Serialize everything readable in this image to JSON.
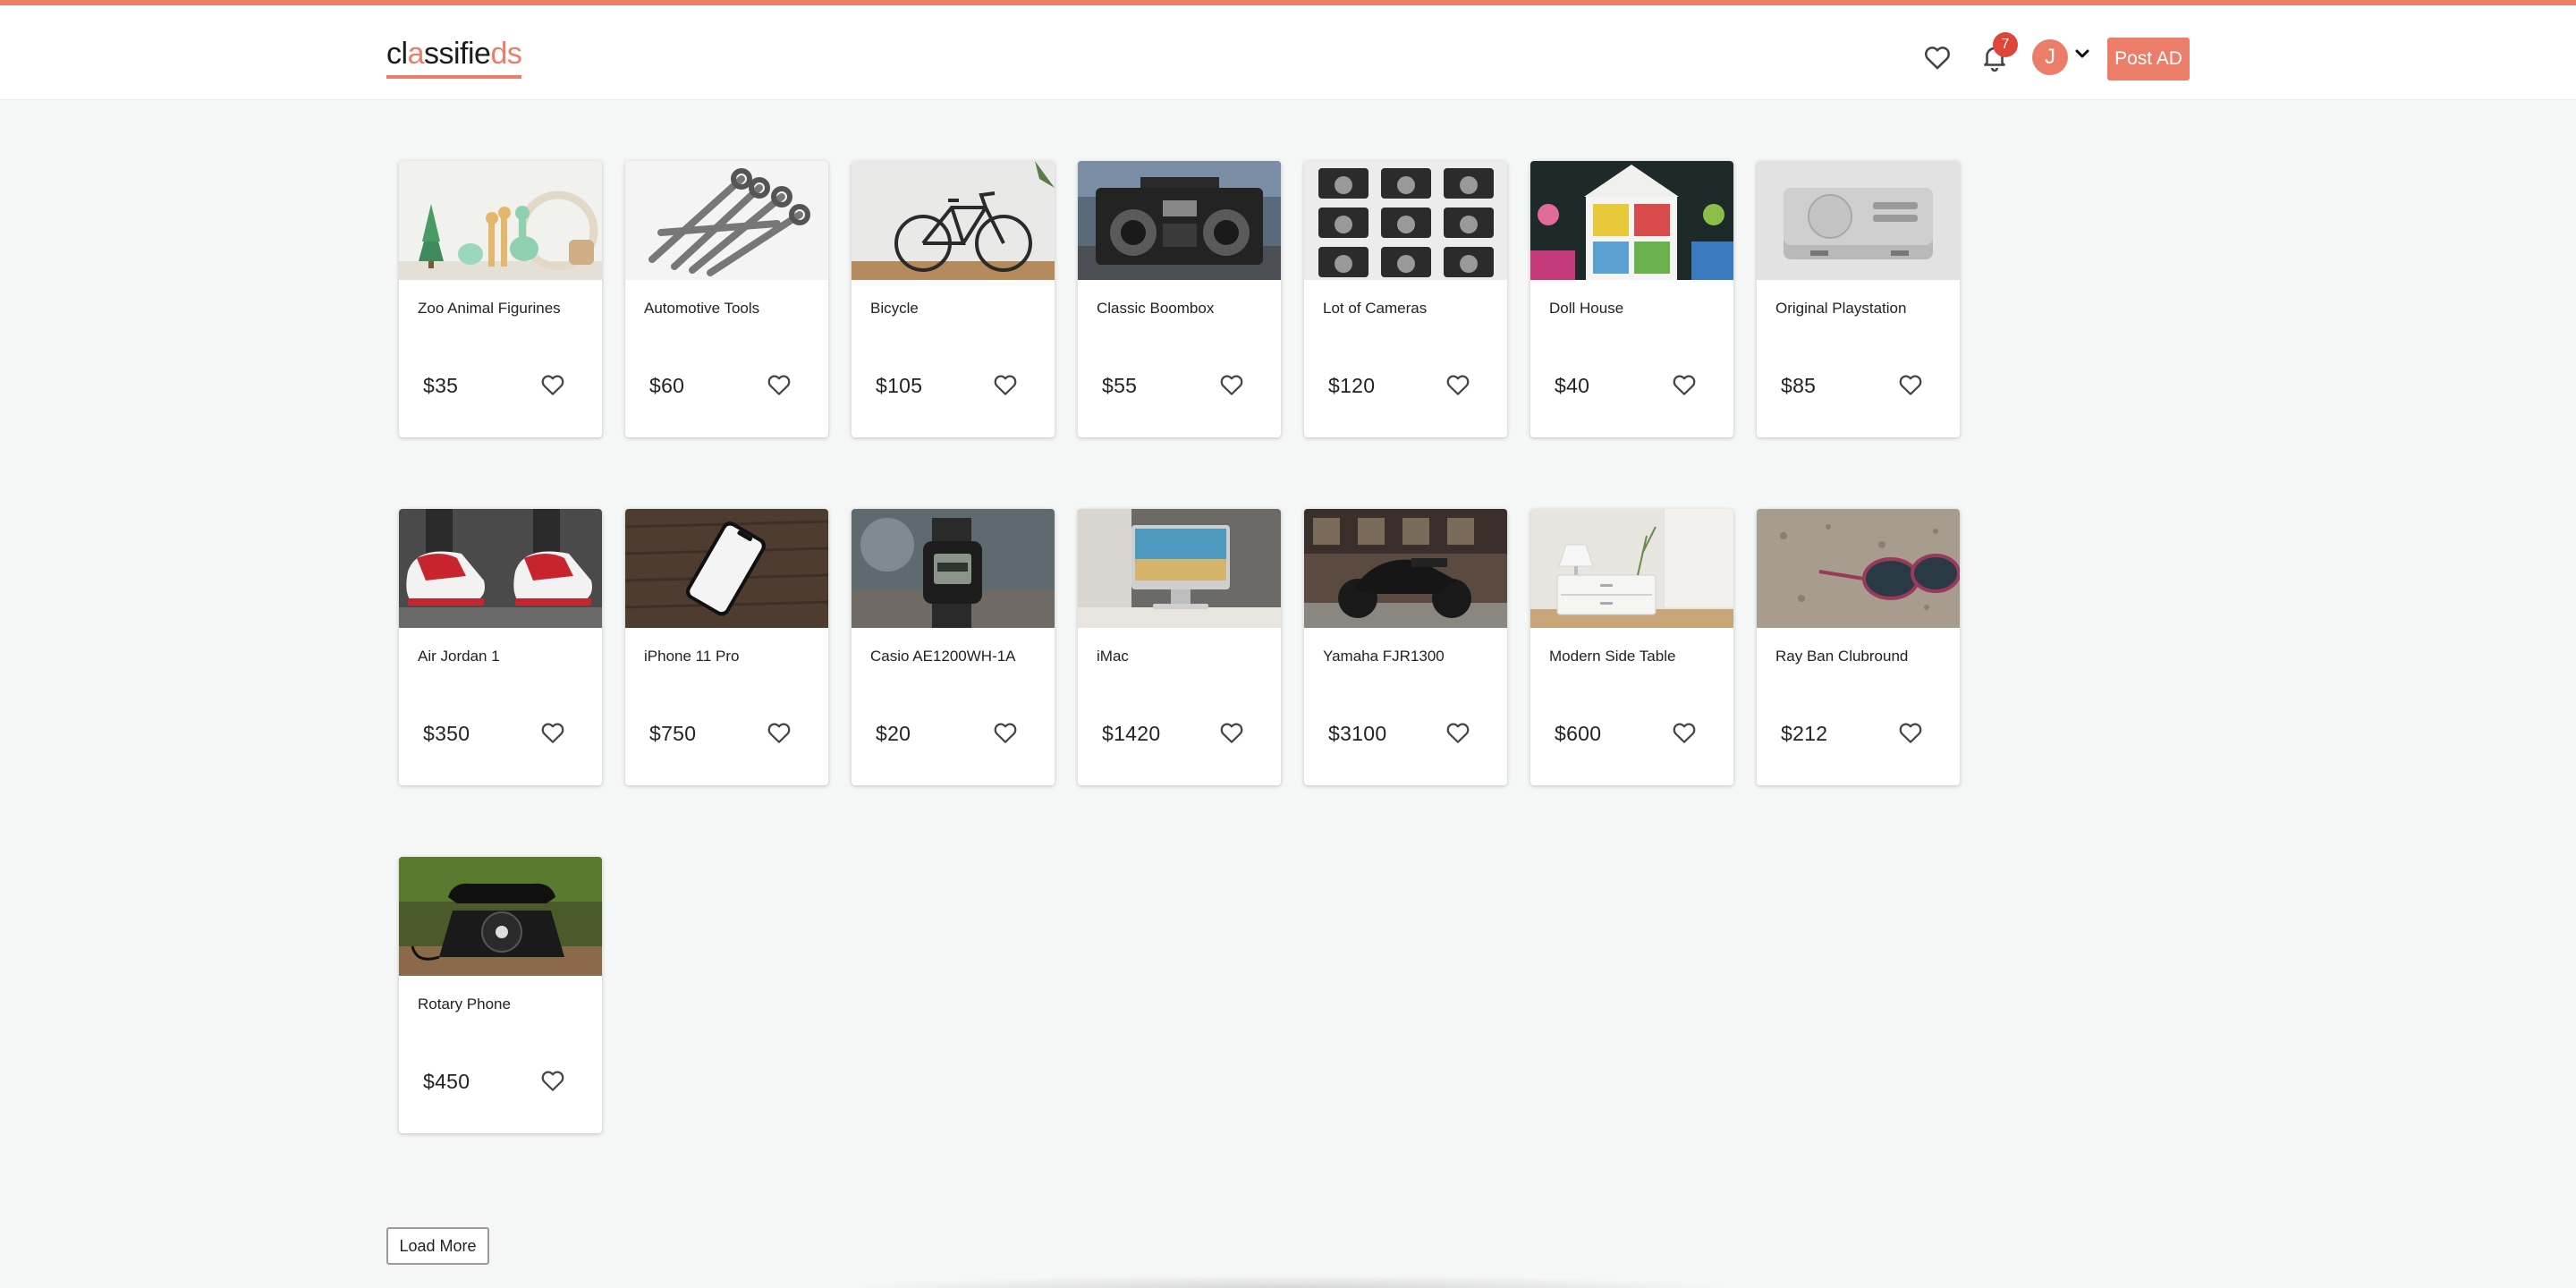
{
  "header": {
    "logo_prefix": "cl",
    "logo_a": "a",
    "logo_mid": "ssifie",
    "logo_suffix": "ds",
    "notification_count": "7",
    "avatar_initial": "J",
    "post_ad_label": "Post AD"
  },
  "colors": {
    "accent": "#ec7d68",
    "badge": "#e0453a",
    "background": "#f5f6f6"
  },
  "listings": [
    {
      "title": "Zoo Animal Figurines",
      "price": "$35",
      "image": "zoo-figurines"
    },
    {
      "title": "Automotive Tools",
      "price": "$60",
      "image": "wrenches"
    },
    {
      "title": "Bicycle",
      "price": "$105",
      "image": "bicycle"
    },
    {
      "title": "Classic Boombox",
      "price": "$55",
      "image": "boombox"
    },
    {
      "title": "Lot of Cameras",
      "price": "$120",
      "image": "cameras"
    },
    {
      "title": "Doll House",
      "price": "$40",
      "image": "dollhouse"
    },
    {
      "title": "Original Playstation",
      "price": "$85",
      "image": "playstation"
    },
    {
      "title": "Air Jordan 1",
      "price": "$350",
      "image": "sneakers"
    },
    {
      "title": "iPhone 11 Pro",
      "price": "$750",
      "image": "iphone"
    },
    {
      "title": "Casio AE1200WH-1A",
      "price": "$20",
      "image": "watch"
    },
    {
      "title": "iMac",
      "price": "$1420",
      "image": "imac"
    },
    {
      "title": "Yamaha FJR1300",
      "price": "$3100",
      "image": "motorcycle"
    },
    {
      "title": "Modern Side Table",
      "price": "$600",
      "image": "side-table"
    },
    {
      "title": "Ray Ban Clubround",
      "price": "$212",
      "image": "sunglasses"
    },
    {
      "title": "Rotary Phone",
      "price": "$450",
      "image": "rotary-phone"
    }
  ],
  "load_more_label": "Load More"
}
